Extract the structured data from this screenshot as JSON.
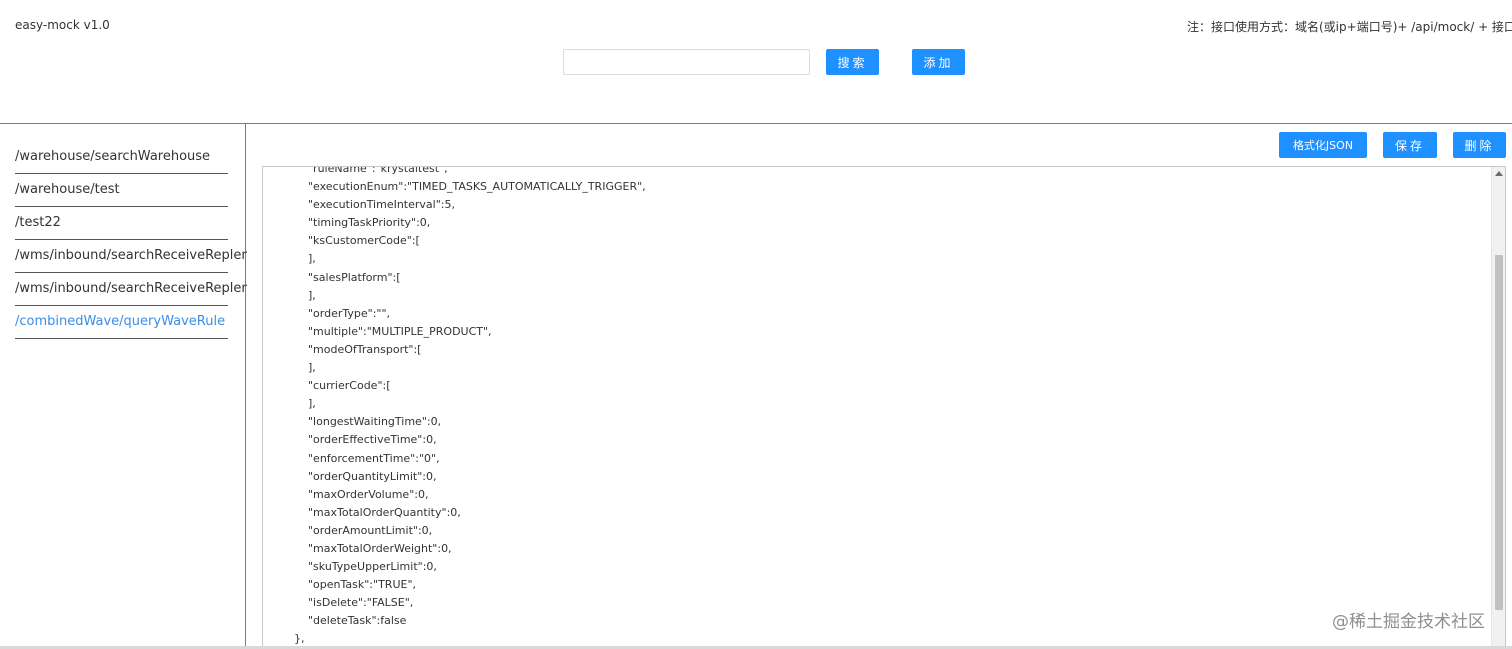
{
  "header": {
    "app_title": "easy-mock v1.0",
    "usage_note": "注：接口使用方式：域名(或ip+端口号)+ /api/mock/ + 接口地址"
  },
  "search": {
    "value": "",
    "placeholder": "",
    "search_label": "搜索",
    "add_label": "添加"
  },
  "toolbar": {
    "format_label": "格式化JSON",
    "save_label": "保存",
    "delete_label": "删除"
  },
  "sidebar": {
    "items": [
      {
        "label": "/warehouse/searchWarehouse",
        "active": false
      },
      {
        "label": "/warehouse/test",
        "active": false
      },
      {
        "label": "/test22",
        "active": false
      },
      {
        "label": "/wms/inbound/searchReceiveReplenishOrder",
        "active": false
      },
      {
        "label": "/wms/inbound/searchReceiveReplenishOrder",
        "active": false
      },
      {
        "label": "/combinedWave/queryWaveRule",
        "active": true
      }
    ]
  },
  "editor": {
    "lines": [
      "\"ruleName\":\"krystaltest\",",
      "\"executionEnum\":\"TIMED_TASKS_AUTOMATICALLY_TRIGGER\",",
      "\"executionTimeInterval\":5,",
      "\"timingTaskPriority\":0,",
      "\"ksCustomerCode\":[",
      "],",
      "\"salesPlatform\":[",
      "],",
      "\"orderType\":\"\",",
      "\"multiple\":\"MULTIPLE_PRODUCT\",",
      "\"modeOfTransport\":[",
      "],",
      "\"currierCode\":[",
      "],",
      "\"longestWaitingTime\":0,",
      "\"orderEffectiveTime\":0,",
      "\"enforcementTime\":\"0\",",
      "\"orderQuantityLimit\":0,",
      "\"maxOrderVolume\":0,",
      "\"maxTotalOrderQuantity\":0,",
      "\"orderAmountLimit\":0,",
      "\"maxTotalOrderWeight\":0,",
      "\"skuTypeUpperLimit\":0,",
      "\"openTask\":\"TRUE\",",
      "\"isDelete\":\"FALSE\",",
      "\"deleteTask\":false",
      "},"
    ]
  },
  "watermark": "@稀土掘金技术社区"
}
